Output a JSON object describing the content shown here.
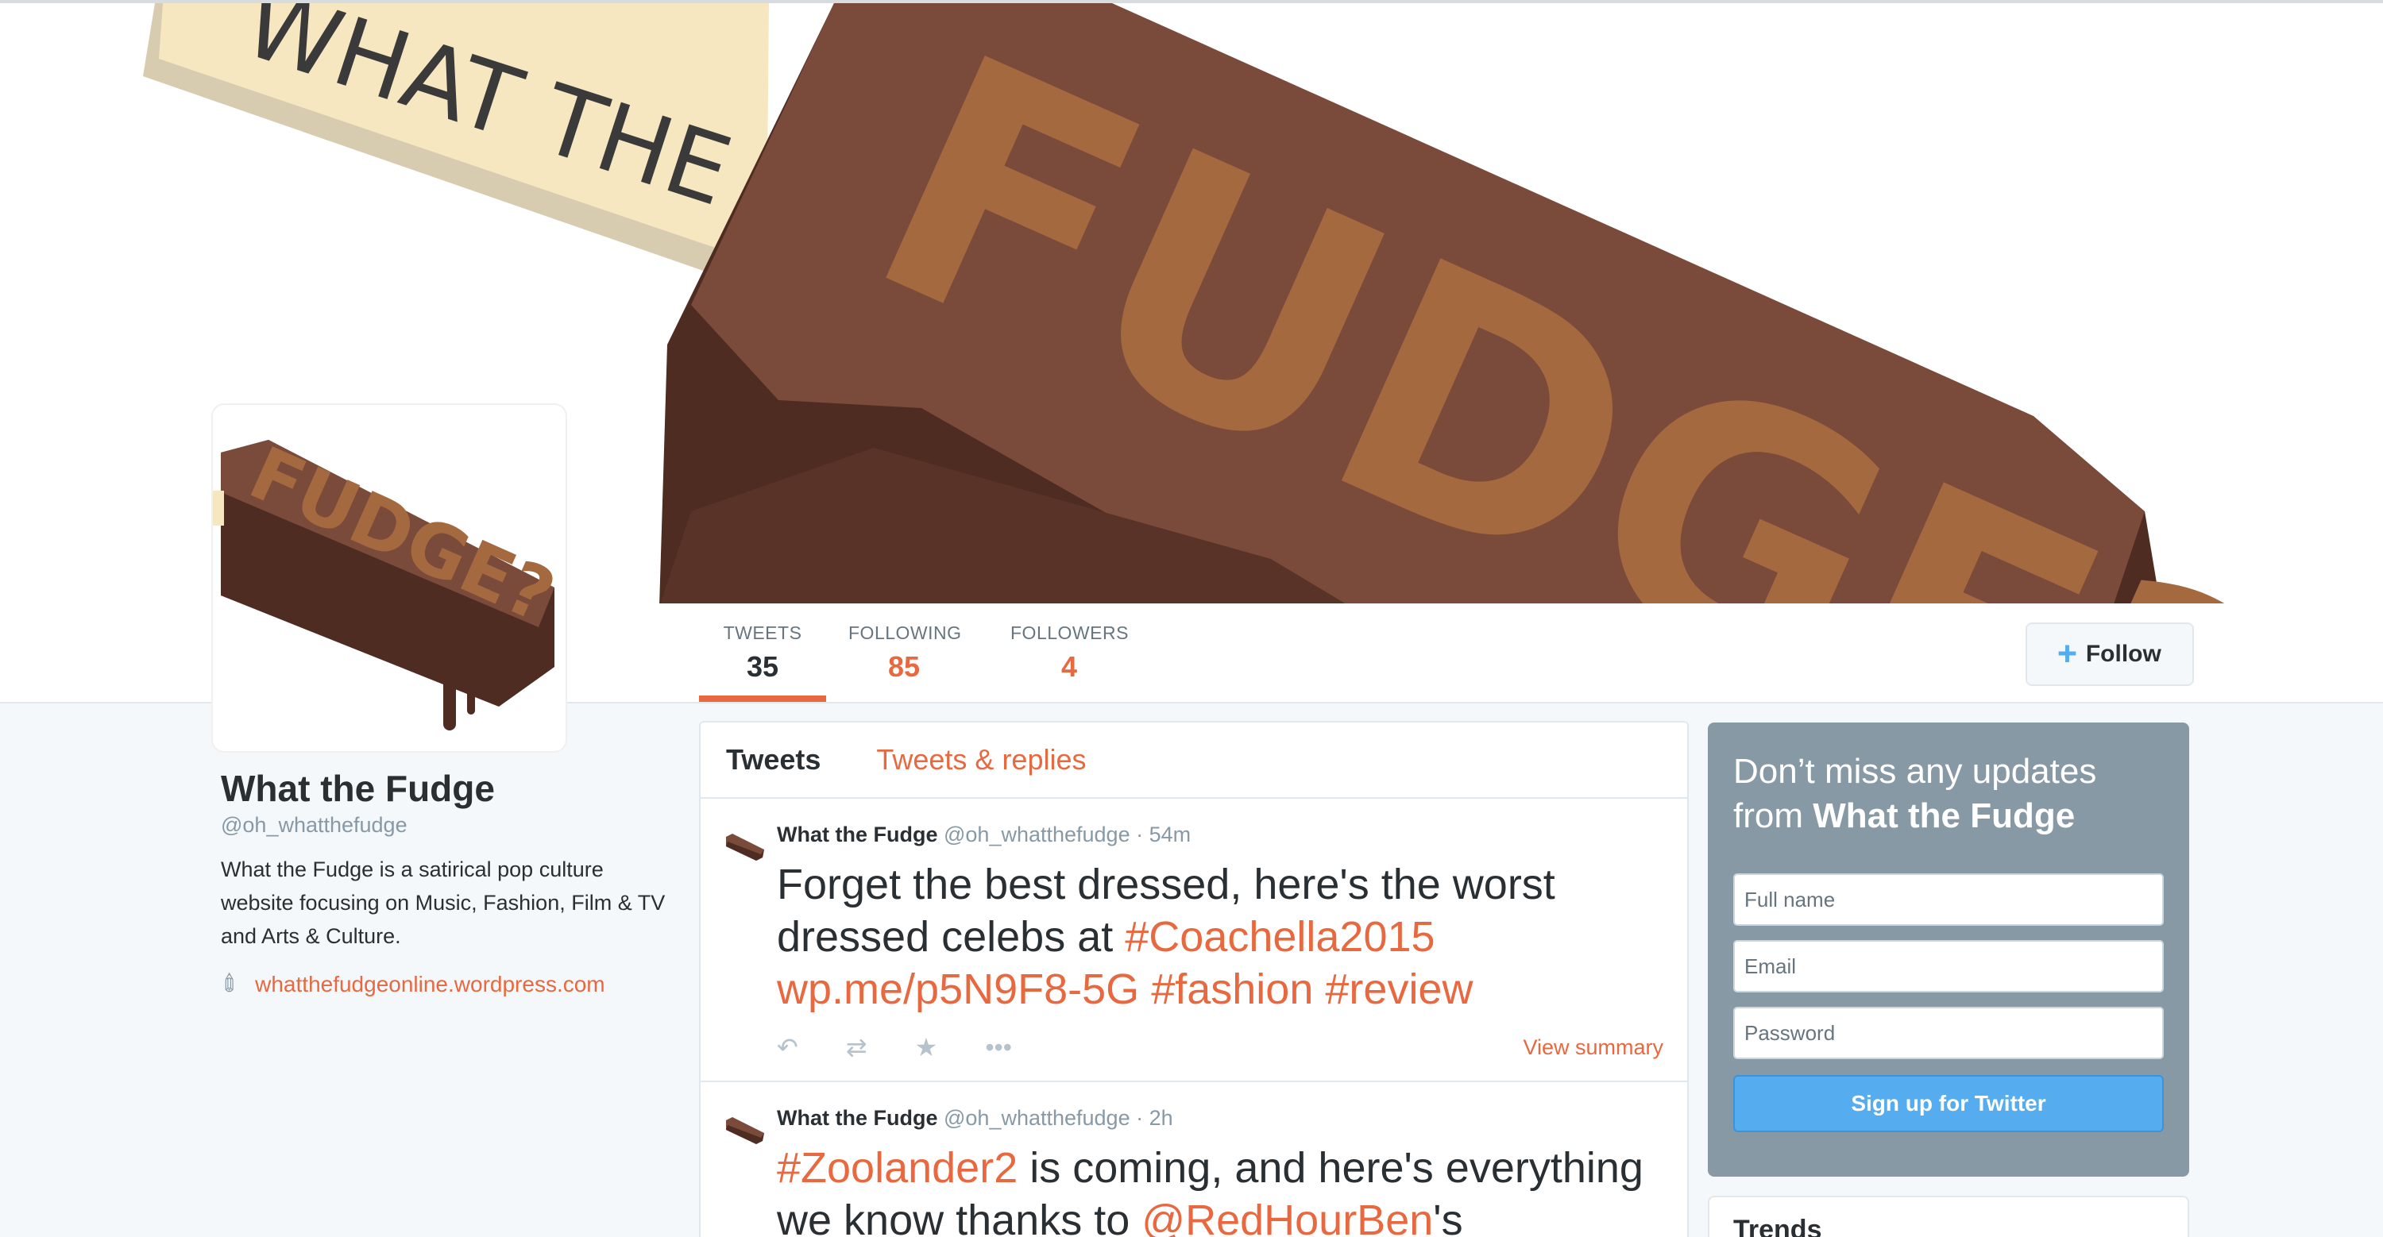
{
  "banner": {
    "stick_text": "WHAT THE",
    "bar_text": "FUDGE?"
  },
  "avatar": {
    "text": "FUDGE?"
  },
  "nav": {
    "stats": [
      {
        "label": "TWEETS",
        "value": "35"
      },
      {
        "label": "FOLLOWING",
        "value": "85"
      },
      {
        "label": "FOLLOWERS",
        "value": "4"
      }
    ],
    "follow_label": "Follow",
    "follow_icon": "add-user-icon"
  },
  "profile": {
    "name": "What the Fudge",
    "handle": "@oh_whatthefudge",
    "bio": "What the Fudge is a satirical pop culture website focusing on Music, Fashion, Film & TV and Arts & Culture.",
    "link": "whatthefudgeonline.wordpress.com",
    "link_icon": "link-icon"
  },
  "timeline": {
    "tabs": [
      "Tweets",
      "Tweets & replies"
    ],
    "tweets": [
      {
        "name": "What the Fudge",
        "handle": "@oh_whatthefudge",
        "time": "· 54m",
        "parts": [
          {
            "text": "Forget the best dressed, here's the worst dressed celebs at ",
            "hl": false
          },
          {
            "text": "#Coachella2015",
            "hl": true
          },
          {
            "text": " ",
            "hl": false
          },
          {
            "text": "wp.me/p5N9F8-5G",
            "hl": true
          },
          {
            "text": " ",
            "hl": false
          },
          {
            "text": "#fashion",
            "hl": true
          },
          {
            "text": " ",
            "hl": false
          },
          {
            "text": "#review",
            "hl": true
          }
        ],
        "summary": "View summary"
      },
      {
        "name": "What the Fudge",
        "handle": "@oh_whatthefudge",
        "time": "· 2h",
        "parts": [
          {
            "text": "#Zoolander2",
            "hl": true
          },
          {
            "text": " is coming, and here's everything we know thanks to ",
            "hl": false
          },
          {
            "text": "@RedHourBen",
            "hl": true
          },
          {
            "text": "'s",
            "hl": false
          }
        ]
      }
    ]
  },
  "signup": {
    "title_prefix": "Don’t miss any updates from ",
    "title_name": "What the Fudge",
    "fullname_placeholder": "Full name",
    "email_placeholder": "Email",
    "password_placeholder": "Password",
    "button": "Sign up for Twitter"
  },
  "trends": {
    "title": "Trends"
  },
  "colors": {
    "accent": "#e8683f",
    "chocolate": "#7a4a3a",
    "chocolate_dark": "#4e2c22",
    "letters": "#a4693f",
    "stick": "#f6e7c1",
    "signup_bg": "#8899a6",
    "button": "#55acee"
  }
}
